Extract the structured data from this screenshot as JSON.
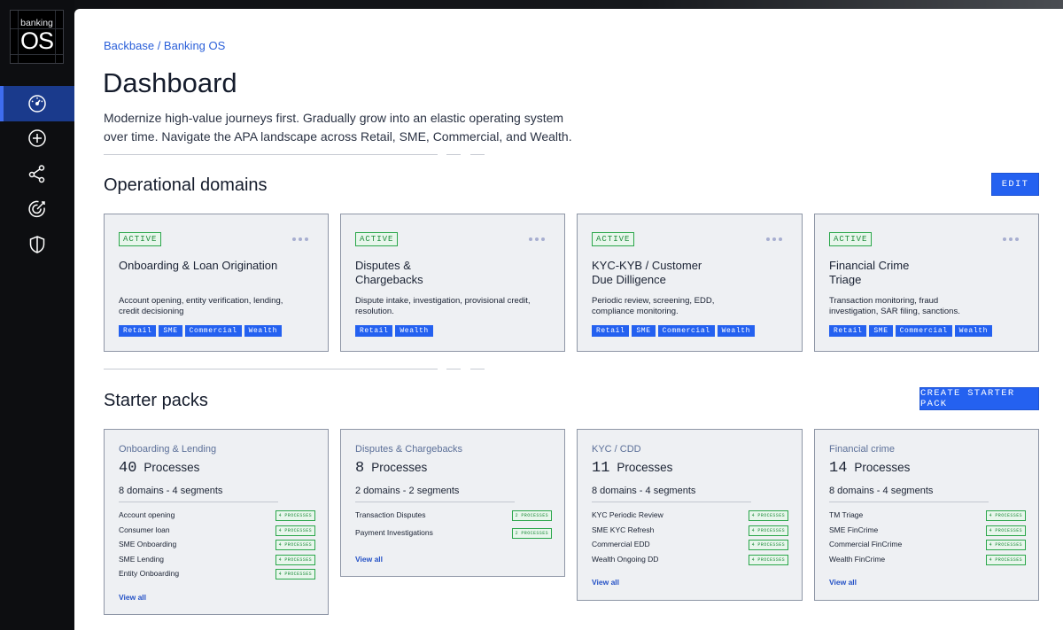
{
  "brand": {
    "line1": "banking",
    "line2": "OS"
  },
  "colors": {
    "accent": "#2461f0",
    "active_green": "#2aa64a",
    "sidebar_bg": "#0d0e11"
  },
  "sidebar": {
    "items": [
      {
        "name": "dashboard",
        "icon": "gauge-icon",
        "active": true
      },
      {
        "name": "add",
        "icon": "plus-circle-icon",
        "active": false
      },
      {
        "name": "network",
        "icon": "share-nodes-icon",
        "active": false
      },
      {
        "name": "target",
        "icon": "target-icon",
        "active": false
      },
      {
        "name": "security",
        "icon": "shield-icon",
        "active": false
      }
    ]
  },
  "breadcrumb": "Backbase / Banking OS",
  "page_title": "Dashboard",
  "page_description": "Modernize high-value journeys first. Gradually grow into an elastic operating system over time. Navigate the APA landscape across Retail, SME, Commercial, and Wealth.",
  "operational": {
    "title": "Operational domains",
    "edit_label": "EDIT",
    "cards": [
      {
        "status": "ACTIVE",
        "title": "Onboarding & Loan Origination",
        "desc": "Account opening, entity verification, lending, credit decisioning",
        "tags": [
          "Retail",
          "SME",
          "Commercial",
          "Wealth"
        ]
      },
      {
        "status": "ACTIVE",
        "title": "Disputes & Chargebacks",
        "desc": "Dispute intake, investigation, provisional credit, resolution.",
        "tags": [
          "Retail",
          "Wealth"
        ]
      },
      {
        "status": "ACTIVE",
        "title": "KYC-KYB / Customer Due Dilligence",
        "desc": "Periodic review, screening, EDD, compliance monitoring.",
        "tags": [
          "Retail",
          "SME",
          "Commercial",
          "Wealth"
        ]
      },
      {
        "status": "ACTIVE",
        "title": "Financial Crime Triage",
        "desc": "Transaction monitoring, fraud investigation, SAR filing, sanctions.",
        "tags": [
          "Retail",
          "SME",
          "Commercial",
          "Wealth"
        ]
      }
    ]
  },
  "starter": {
    "title": "Starter packs",
    "create_label": "CREATE STARTER PACK",
    "cards": [
      {
        "category": "Onboarding & Lending",
        "count": "40",
        "processes_label": "Processes",
        "meta": "8 domains - 4 segments",
        "items": [
          {
            "label": "Account opening",
            "badge": "4 PROCESSES"
          },
          {
            "label": "Consumer loan",
            "badge": "4 PROCESSES"
          },
          {
            "label": "SME  Onboarding",
            "badge": "4 PROCESSES"
          },
          {
            "label": "SME Lending",
            "badge": "4 PROCESSES"
          },
          {
            "label": "Entity Onboarding",
            "badge": "4 PROCESSES"
          }
        ],
        "view_all": "View all"
      },
      {
        "category": "Disputes & Chargebacks",
        "count": "8",
        "processes_label": "Processes",
        "meta": "2 domains - 2 segments",
        "items": [
          {
            "label": "Transaction Disputes",
            "badge": "2 PROCESSES"
          },
          {
            "label": "Payment Investigations",
            "badge": "2 PROCESSES"
          }
        ],
        "view_all": "View all"
      },
      {
        "category": "KYC / CDD",
        "count": "11",
        "processes_label": "Processes",
        "meta": "8 domains - 4 segments",
        "items": [
          {
            "label": "KYC Periodic Review",
            "badge": "4 PROCESSES"
          },
          {
            "label": "SME KYC Refresh",
            "badge": "4 PROCESSES"
          },
          {
            "label": "Commercial EDD",
            "badge": "4 PROCESSES"
          },
          {
            "label": "Wealth Ongoing DD",
            "badge": "4 PROCESSES"
          }
        ],
        "view_all": "View all"
      },
      {
        "category": "Financial crime",
        "count": "14",
        "processes_label": "Processes",
        "meta": "8 domains - 4 segments",
        "items": [
          {
            "label": "TM Triage",
            "badge": "4 PROCESSES"
          },
          {
            "label": "SME FinCrime",
            "badge": "4 PROCESSES"
          },
          {
            "label": "Commercial FinCrime",
            "badge": "4 PROCESSES"
          },
          {
            "label": "Wealth FinCrime",
            "badge": "4 PROCESSES"
          }
        ],
        "view_all": "View all"
      }
    ]
  }
}
